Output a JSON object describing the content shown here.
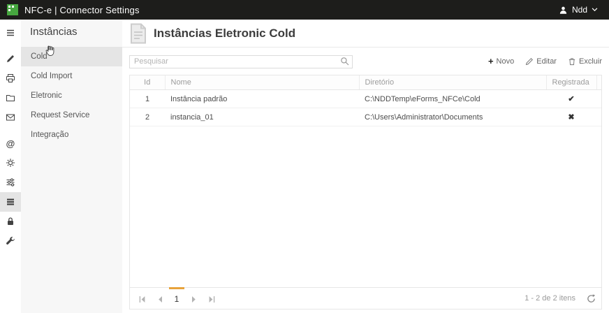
{
  "topbar": {
    "title": "NFC-e | Connector Settings",
    "user_name": "Ndd"
  },
  "iconbar": {
    "icons": [
      "menu",
      "brush",
      "printer",
      "folder",
      "mail",
      "at",
      "settings",
      "sliders",
      "instances",
      "lock",
      "wrench"
    ]
  },
  "sidebar": {
    "title": "Instâncias",
    "items": [
      {
        "label": "Cold",
        "selected": true
      },
      {
        "label": "Cold Import",
        "selected": false
      },
      {
        "label": "Eletronic",
        "selected": false
      },
      {
        "label": "Request Service",
        "selected": false
      },
      {
        "label": "Integração",
        "selected": false
      }
    ]
  },
  "main": {
    "title": "Instâncias Eletronic Cold",
    "search_placeholder": "Pesquisar",
    "toolbar": {
      "new_label": "Novo",
      "edit_label": "Editar",
      "delete_label": "Excluir"
    },
    "table": {
      "columns": [
        "Id",
        "Nome",
        "Diretório",
        "Registrada"
      ],
      "rows": [
        {
          "id": "1",
          "nome": "Instância padrão",
          "diretorio": "C:\\NDDTemp\\eForms_NFCe\\Cold",
          "registrada": "✔"
        },
        {
          "id": "2",
          "nome": "instancia_01",
          "diretorio": "C:\\Users\\Administrator\\Documents",
          "registrada": "✖"
        }
      ]
    },
    "pager": {
      "page": "1",
      "info": "1 - 2 de 2 itens"
    }
  },
  "colors": {
    "accent_green": "#46a63f",
    "accent_orange": "#e8a33b",
    "topbar_bg": "#1d1d1b"
  }
}
